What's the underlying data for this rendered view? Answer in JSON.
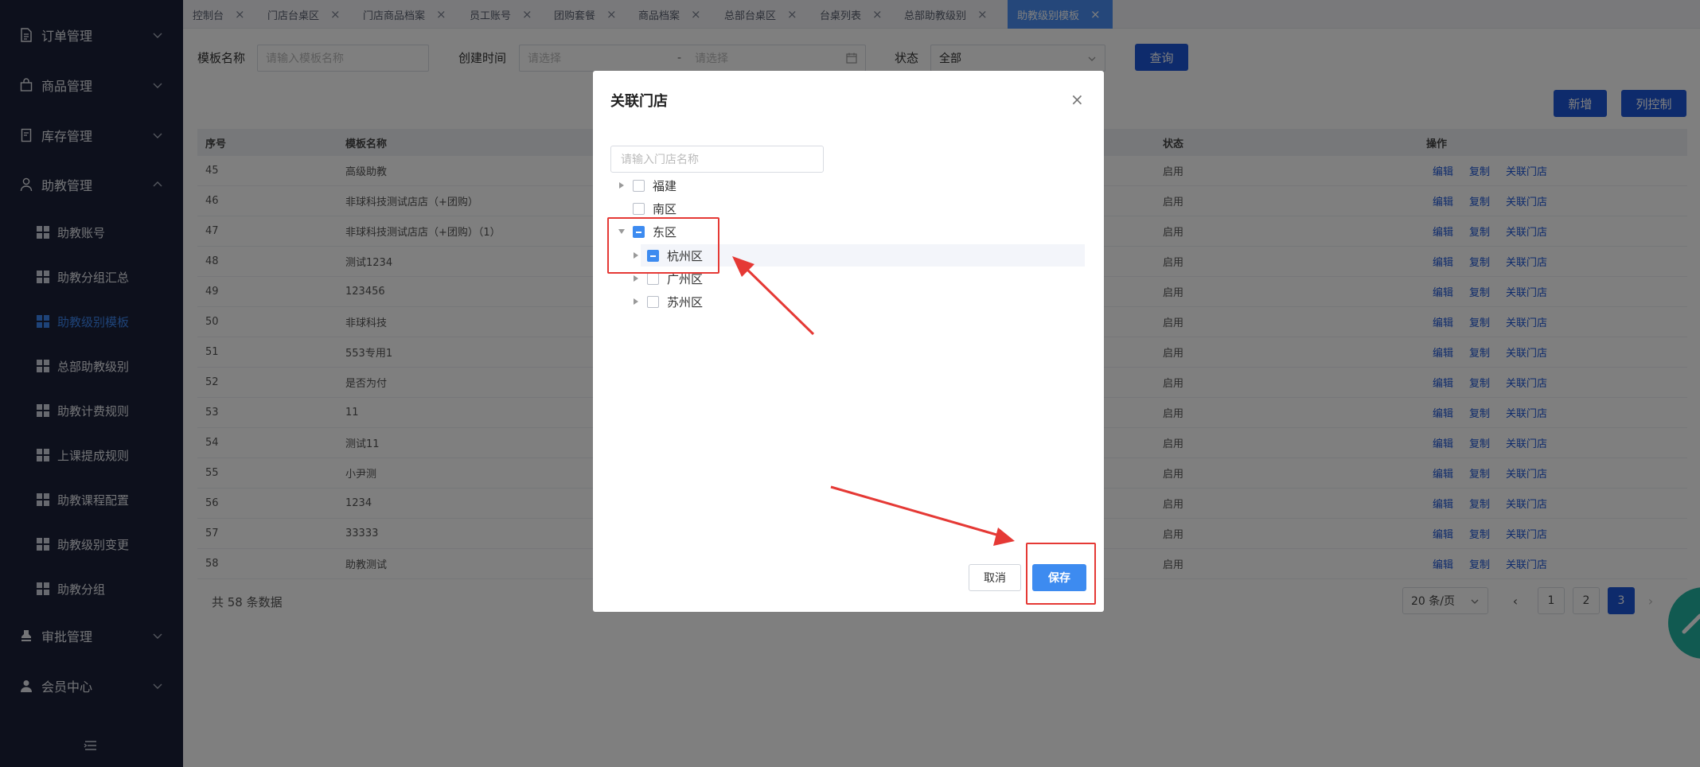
{
  "sidebar": {
    "groups": [
      {
        "label": "订单管理",
        "icon": "document-icon"
      },
      {
        "label": "商品管理",
        "icon": "bag-icon"
      },
      {
        "label": "库存管理",
        "icon": "inventory-icon"
      },
      {
        "label": "助教管理",
        "icon": "user-icon"
      },
      {
        "label": "审批管理",
        "icon": "approval-icon"
      },
      {
        "label": "会员中心",
        "icon": "member-icon"
      }
    ],
    "sub_items": [
      {
        "label": "助教账号"
      },
      {
        "label": "助教分组汇总"
      },
      {
        "label": "助教级别模板"
      },
      {
        "label": "总部助教级别"
      },
      {
        "label": "助教计费规则"
      },
      {
        "label": "上课提成规则"
      },
      {
        "label": "助教课程配置"
      },
      {
        "label": "助教级别变更"
      },
      {
        "label": "助教分组"
      }
    ],
    "active_item": "助教级别模板"
  },
  "tabs": [
    {
      "label": "控制台"
    },
    {
      "label": "门店台桌区"
    },
    {
      "label": "门店商品档案"
    },
    {
      "label": "员工账号"
    },
    {
      "label": "团购套餐"
    },
    {
      "label": "商品档案"
    },
    {
      "label": "总部台桌区"
    },
    {
      "label": "台桌列表"
    },
    {
      "label": "总部助教级别"
    },
    {
      "label": "助教级别模板"
    }
  ],
  "filters": {
    "template_name_label": "模板名称",
    "template_name_placeholder": "请输入模板名称",
    "created_time_label": "创建时间",
    "start_placeholder": "请选择",
    "range_sep": "-",
    "end_placeholder": "请选择",
    "status_label": "状态",
    "status_value": "全部",
    "query_button": "查询"
  },
  "actions": {
    "add_button": "新增",
    "columns_button": "列控制"
  },
  "table": {
    "headers": {
      "index": "序号",
      "name": "模板名称",
      "status": "状态",
      "ops": "操作"
    },
    "op_labels": {
      "edit": "编辑",
      "copy": "复制",
      "link": "关联门店"
    },
    "rows": [
      {
        "index": "45",
        "name": "高级助教",
        "status": "启用"
      },
      {
        "index": "46",
        "name": "非球科技测试店店（+团购）",
        "status": "启用"
      },
      {
        "index": "47",
        "name": "非球科技测试店店（+团购）（1）",
        "status": "启用"
      },
      {
        "index": "48",
        "name": "测试1234",
        "status": "启用"
      },
      {
        "index": "49",
        "name": "123456",
        "status": "启用"
      },
      {
        "index": "50",
        "name": "非球科技",
        "status": "启用"
      },
      {
        "index": "51",
        "name": "553专用1",
        "status": "启用"
      },
      {
        "index": "52",
        "name": "是否为付",
        "status": "启用"
      },
      {
        "index": "53",
        "name": "11",
        "status": "启用"
      },
      {
        "index": "54",
        "name": "测试11",
        "status": "启用"
      },
      {
        "index": "55",
        "name": "小尹测",
        "status": "启用"
      },
      {
        "index": "56",
        "name": "1234",
        "status": "启用"
      },
      {
        "index": "57",
        "name": "33333",
        "status": "启用"
      },
      {
        "index": "58",
        "name": "助教测试",
        "status": "启用"
      }
    ]
  },
  "footer": {
    "total_text": "共 58 条数据",
    "page_size": "20 条/页",
    "pages": [
      "1",
      "2",
      "3"
    ],
    "current_page": "3"
  },
  "modal": {
    "title": "关联门店",
    "search_placeholder": "请输入门店名称",
    "tree": [
      {
        "label": "福建",
        "level": 0,
        "expandable": true,
        "state": "unchecked"
      },
      {
        "label": "南区",
        "level": 0,
        "expandable": false,
        "state": "unchecked"
      },
      {
        "label": "东区",
        "level": 0,
        "expandable": true,
        "expanded": true,
        "state": "indeterminate"
      },
      {
        "label": "杭州区",
        "level": 1,
        "expandable": true,
        "state": "indeterminate"
      },
      {
        "label": "广州区",
        "level": 1,
        "expandable": true,
        "state": "unchecked"
      },
      {
        "label": "苏州区",
        "level": 1,
        "expandable": true,
        "state": "unchecked"
      }
    ],
    "cancel_button": "取消",
    "save_button": "保存"
  },
  "colors": {
    "sidebar_bg": "#1b2138",
    "primary": "#1d56d8",
    "accent": "#3d8bf0",
    "annotation": "#e53935"
  }
}
